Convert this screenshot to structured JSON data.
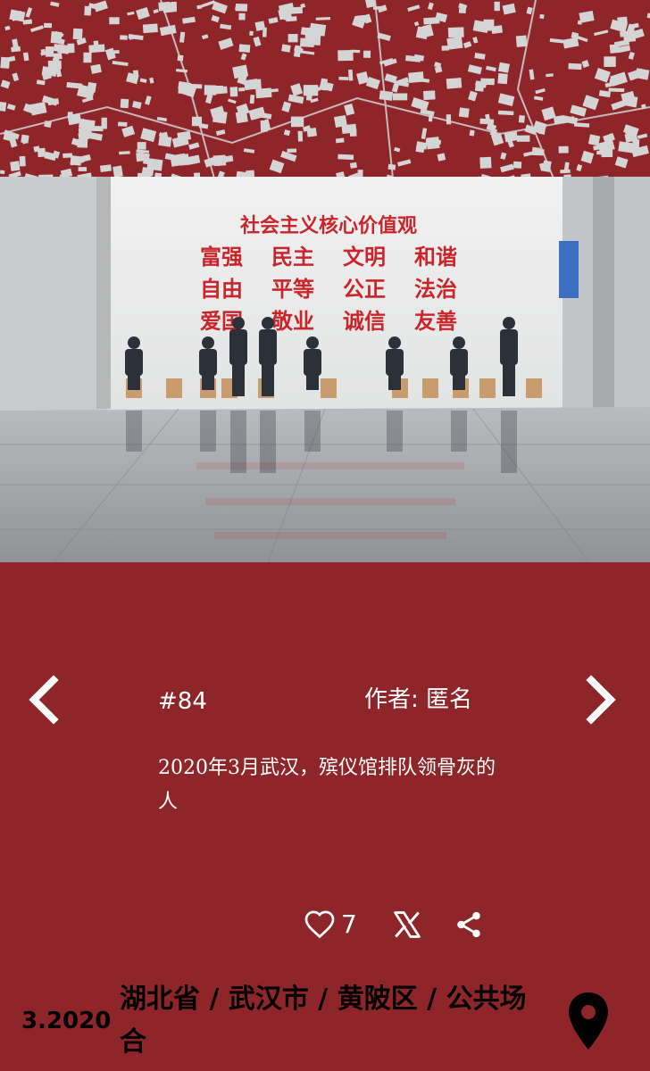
{
  "map": {
    "color": "#8e2528",
    "building_color": "#d4d4d4"
  },
  "photo": {
    "wall_slogan": {
      "title": "社会主义核心价值观",
      "rows": [
        [
          "富强",
          "民主",
          "文明",
          "和谐"
        ],
        [
          "自由",
          "平等",
          "公正",
          "法治"
        ],
        [
          "爱国",
          "敬业",
          "诚信",
          "友善"
        ]
      ],
      "color": "#c8262a"
    }
  },
  "entry": {
    "number": "#84",
    "author_label": "作者:",
    "author_name": "匿名",
    "caption": "2020年3月武汉，殡仪馆排队领骨灰的人"
  },
  "actions": {
    "like_count": "7"
  },
  "footer": {
    "date": "3.2020",
    "location": "湖北省 / 武汉市 / 黄陂区 / 公共场合"
  },
  "icons": {
    "prev": "chevron-left-icon",
    "next": "chevron-right-icon",
    "like": "heart-outline-icon",
    "x": "x-logo-icon",
    "share": "share-icon",
    "pin": "map-pin-icon"
  },
  "colors": {
    "background": "#8e2528",
    "text": "#ffffff",
    "footer_text": "#000000"
  }
}
